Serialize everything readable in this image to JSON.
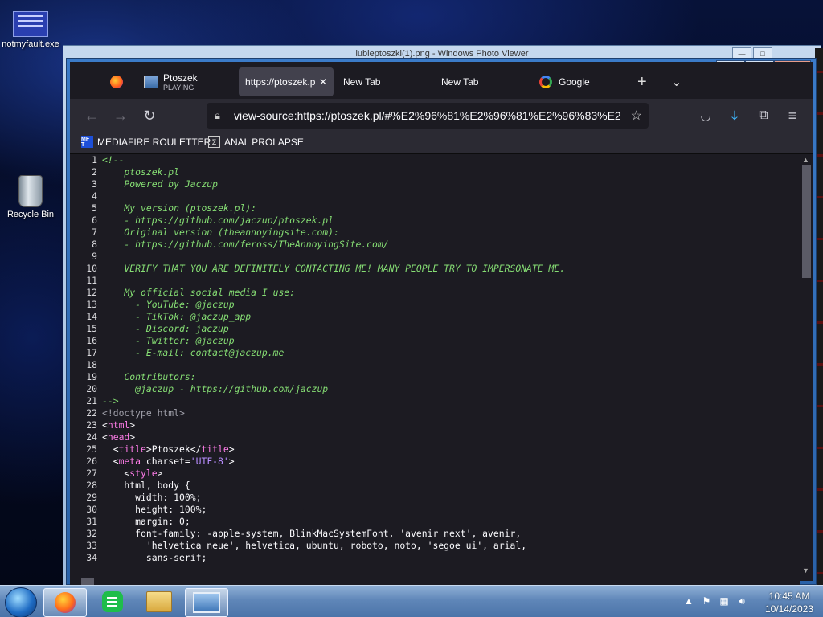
{
  "desktop": {
    "icons": [
      {
        "label": "notmyfault.exe"
      },
      {
        "label": "Recycle Bin"
      }
    ]
  },
  "photo_viewer": {
    "title": "lubieptoszki(1).png - Windows Photo Viewer"
  },
  "browser": {
    "tabs": [
      {
        "title": "Ptoszek",
        "subtitle": "PLAYING"
      },
      {
        "title": "https://ptoszek.p"
      },
      {
        "title": "New Tab"
      },
      {
        "title": "New Tab"
      },
      {
        "title": "Google"
      }
    ],
    "new_tab_glyph": "+",
    "list_tabs_glyph": "⌄",
    "url": "view-source:https://ptoszek.pl/#%E2%96%81%E2%96%81%E2%96%83%E2%96",
    "bookmarks": [
      {
        "icon_text": "MF T",
        "label": "MEDIAFIRE ROULETTER"
      },
      {
        "icon_text": "Σ",
        "label": "ANAL PROLAPSE"
      }
    ],
    "source_lines": [
      {
        "n": "1",
        "t": "<!--",
        "k": "comment"
      },
      {
        "n": "2",
        "t": "    ptoszek.pl",
        "k": "comment"
      },
      {
        "n": "3",
        "t": "    Powered by Jaczup",
        "k": "comment"
      },
      {
        "n": "4",
        "t": "",
        "k": "comment"
      },
      {
        "n": "5",
        "t": "    My version (ptoszek.pl):",
        "k": "comment"
      },
      {
        "n": "6",
        "t": "    - https://github.com/jaczup/ptoszek.pl",
        "k": "comment"
      },
      {
        "n": "7",
        "t": "    Original version (theannoyingsite.com):",
        "k": "comment"
      },
      {
        "n": "8",
        "t": "    - https://github.com/feross/TheAnnoyingSite.com/",
        "k": "comment"
      },
      {
        "n": "9",
        "t": "",
        "k": "comment"
      },
      {
        "n": "10",
        "t": "    VERIFY THAT YOU ARE DEFINITELY CONTACTING ME! MANY PEOPLE TRY TO IMPERSONATE ME.",
        "k": "comment"
      },
      {
        "n": "11",
        "t": "",
        "k": "comment"
      },
      {
        "n": "12",
        "t": "    My official social media I use:",
        "k": "comment"
      },
      {
        "n": "13",
        "t": "      - YouTube: @jaczup",
        "k": "comment"
      },
      {
        "n": "14",
        "t": "      - TikTok: @jaczup_app",
        "k": "comment"
      },
      {
        "n": "15",
        "t": "      - Discord: jaczup",
        "k": "comment"
      },
      {
        "n": "16",
        "t": "      - Twitter: @jaczup",
        "k": "comment"
      },
      {
        "n": "17",
        "t": "      - E-mail: contact@jaczup.me",
        "k": "comment"
      },
      {
        "n": "18",
        "t": "",
        "k": "comment"
      },
      {
        "n": "19",
        "t": "    Contributors:",
        "k": "comment"
      },
      {
        "n": "20",
        "t": "      @jaczup - https://github.com/jaczup",
        "k": "comment"
      },
      {
        "n": "21",
        "t": "-->",
        "k": "comment"
      },
      {
        "n": "22",
        "t": "<!doctype html>",
        "k": "doc"
      },
      {
        "n": "23",
        "parts": [
          [
            "<",
            "plain"
          ],
          [
            "html",
            "tag"
          ],
          [
            ">",
            "plain"
          ]
        ]
      },
      {
        "n": "24",
        "parts": [
          [
            "<",
            "plain"
          ],
          [
            "head",
            "tag"
          ],
          [
            ">",
            "plain"
          ]
        ]
      },
      {
        "n": "25",
        "parts": [
          [
            "  <",
            "plain"
          ],
          [
            "title",
            "tag"
          ],
          [
            ">Ptoszek</",
            "plain"
          ],
          [
            "title",
            "tag"
          ],
          [
            ">",
            "plain"
          ]
        ]
      },
      {
        "n": "26",
        "parts": [
          [
            "  <",
            "plain"
          ],
          [
            "meta",
            "tag"
          ],
          [
            " charset=",
            "plain"
          ],
          [
            "'UTF-8'",
            "val"
          ],
          [
            ">",
            "plain"
          ]
        ]
      },
      {
        "n": "27",
        "parts": [
          [
            "    <",
            "plain"
          ],
          [
            "style",
            "tag"
          ],
          [
            ">",
            "plain"
          ]
        ]
      },
      {
        "n": "28",
        "t": "    html, body {",
        "k": "plain"
      },
      {
        "n": "29",
        "t": "      width: 100%;",
        "k": "plain"
      },
      {
        "n": "30",
        "t": "      height: 100%;",
        "k": "plain"
      },
      {
        "n": "31",
        "t": "      margin: 0;",
        "k": "plain"
      },
      {
        "n": "32",
        "t": "      font-family: -apple-system, BlinkMacSystemFont, 'avenir next', avenir,",
        "k": "plain"
      },
      {
        "n": "33",
        "t": "        'helvetica neue', helvetica, ubuntu, roboto, noto, 'segoe ui', arial,",
        "k": "plain"
      },
      {
        "n": "34",
        "t": "        sans-serif;",
        "k": "plain"
      }
    ]
  },
  "taskbar": {
    "time": "10:45 AM",
    "date": "10/14/2023"
  },
  "colors": {
    "comment": "#86de74",
    "tag": "#ff7de9",
    "value": "#b98eff",
    "browser_bg": "#1c1b22"
  }
}
